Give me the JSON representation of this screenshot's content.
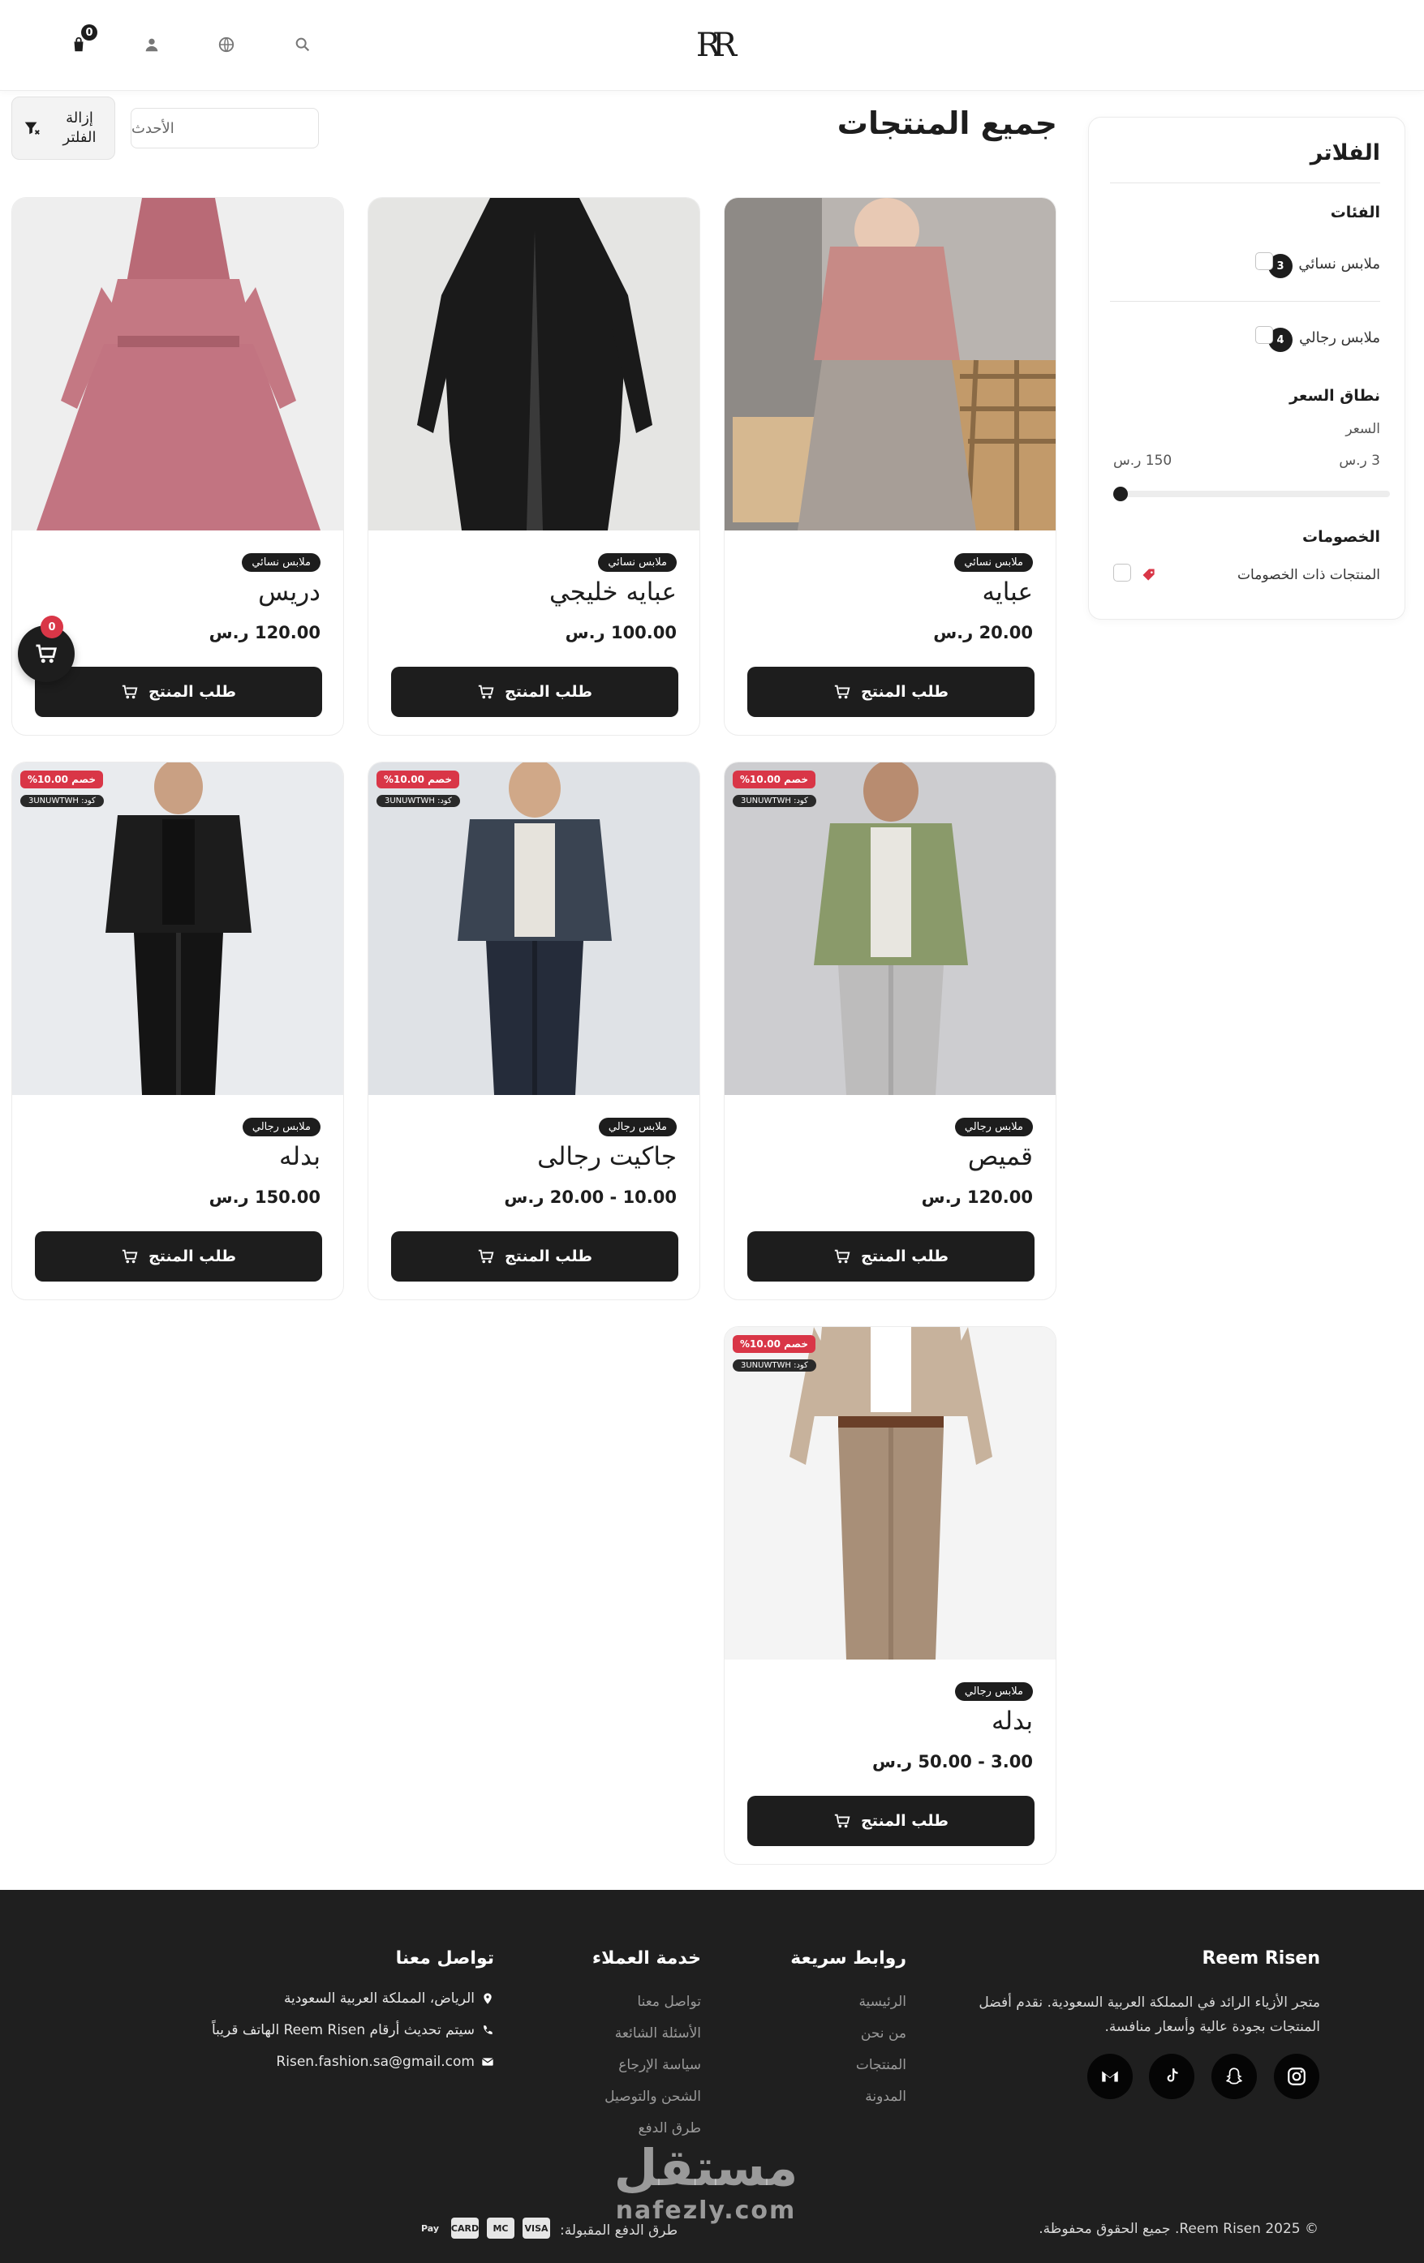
{
  "header": {
    "cart_count": "0",
    "logo_text": "RR"
  },
  "toolbar": {
    "page_title": "جميع المنتجات",
    "sort_value": "الأحدث",
    "clear_filter_label": "إزالة الفلتر"
  },
  "filters": {
    "title": "الفلاتر",
    "categories_title": "الفئات",
    "categories": [
      {
        "label": "ملابس نسائي",
        "count": "3"
      },
      {
        "label": "ملابس رجالي",
        "count": "4"
      }
    ],
    "price_title": "نطاق السعر",
    "price_label": "السعر",
    "price_min": "3 ر.س",
    "price_max": "150 ر.س",
    "discounts_title": "الخصومات",
    "discounted_label": "المنتجات ذات الخصومات"
  },
  "products": [
    {
      "name": "عبايه",
      "category": "ملابس نسائي",
      "price": "20.00 ر.س",
      "button": "طلب المنتج"
    },
    {
      "name": "عبايه خليجي",
      "category": "ملابس نسائي",
      "price": "100.00 ر.س",
      "button": "طلب المنتج"
    },
    {
      "name": "دريس",
      "category": "ملابس نسائي",
      "price": "120.00 ر.س",
      "button": "طلب المنتج"
    },
    {
      "name": "قميص",
      "category": "ملابس رجالي",
      "price": "120.00 ر.س",
      "button": "طلب المنتج",
      "discount": "%10.00 خصم",
      "code": "كود: 3UNUWTWH"
    },
    {
      "name": "جاكيت رجالى",
      "category": "ملابس رجالي",
      "price": "10.00 - 20.00 ر.س",
      "button": "طلب المنتج",
      "discount": "%10.00 خصم",
      "code": "كود: 3UNUWTWH"
    },
    {
      "name": "بدله",
      "category": "ملابس رجالي",
      "price": "150.00 ر.س",
      "button": "طلب المنتج",
      "discount": "%10.00 خصم",
      "code": "كود: 3UNUWTWH"
    },
    {
      "name": "بدله",
      "category": "ملابس رجالي",
      "price": "3.00 - 50.00 ر.س",
      "button": "طلب المنتج",
      "discount": "%10.00 خصم",
      "code": "كود: 3UNUWTWH"
    }
  ],
  "floating_cart": {
    "count": "0"
  },
  "footer": {
    "brand": "Reem Risen",
    "about_line1": "متجر الأزياء الرائد في المملكة العربية السعودية. نقدم أفضل",
    "about_line2": "المنتجات بجودة عالية وأسعار منافسة.",
    "quick_links_title": "روابط سريعة",
    "quick_links": [
      "الرئيسية",
      "من نحن",
      "المنتجات",
      "المدونة"
    ],
    "service_title": "خدمة العملاء",
    "service_links": [
      "تواصل معنا",
      "الأسئلة الشائعة",
      "سياسة الإرجاع",
      "الشحن والتوصيل",
      "طرق الدفع"
    ],
    "contact_title": "تواصل معنا",
    "address": "الرياض، المملكة العربية السعودية",
    "phone": "سيتم تحديث أرقام Reem Risen الهاتف قريباً",
    "email": "Risen.fashion.sa@gmail.com",
    "copyright": "© 2025 Reem Risen. جميع الحقوق محفوظة.",
    "payment_label": "طرق الدفع المقبولة:",
    "payment_icons": [
      "VISA",
      "MC",
      "CARD",
      "Pay"
    ]
  },
  "watermark": {
    "line1": "مستقل",
    "line2": "nafezly.com"
  }
}
